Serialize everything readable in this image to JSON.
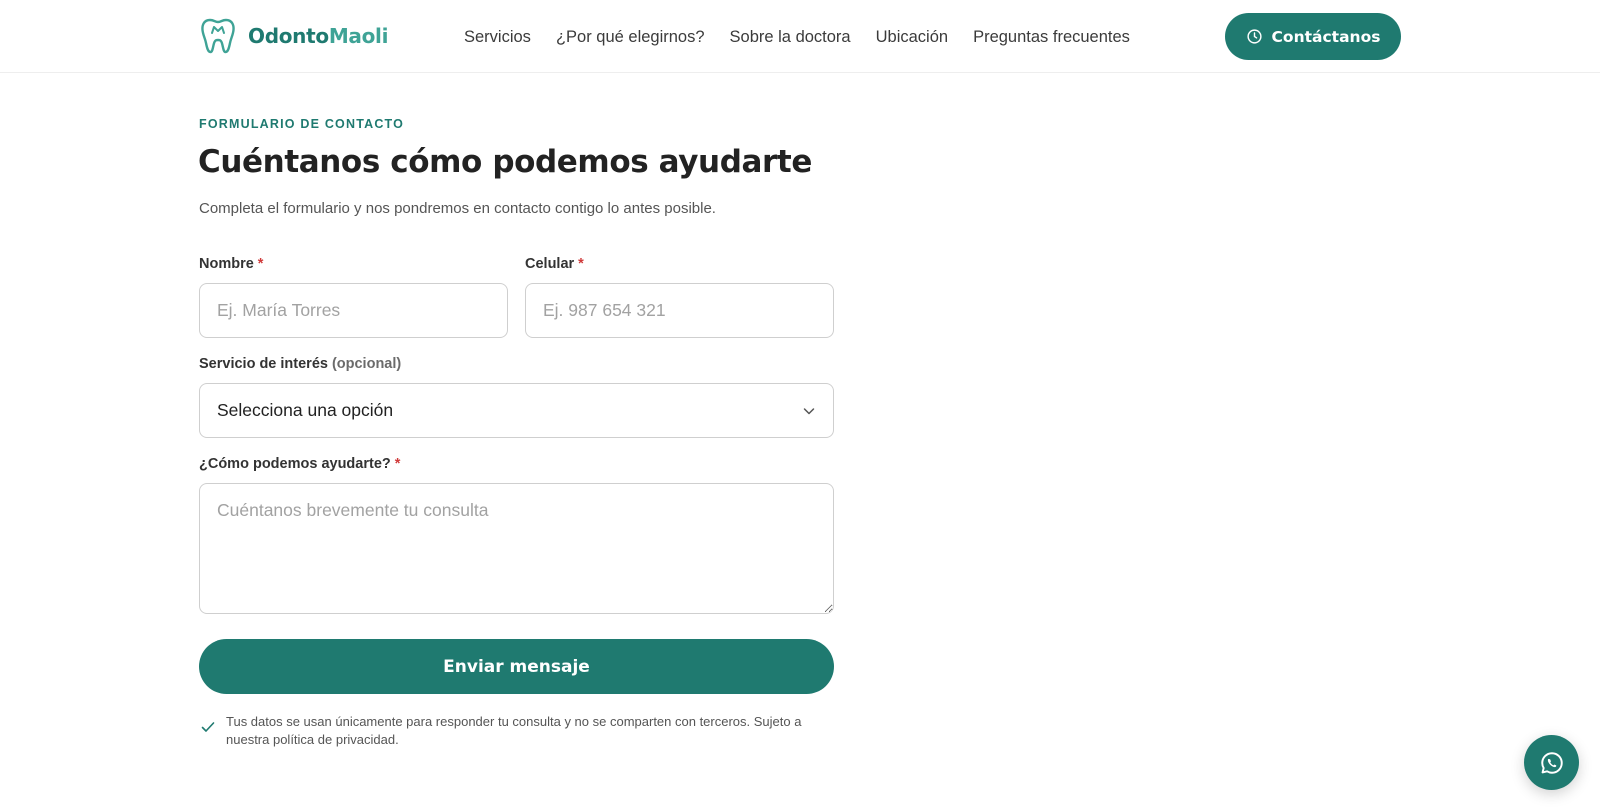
{
  "brand": {
    "name_part1": "Odonto",
    "name_part2": "Maoli",
    "colors": {
      "primary": "#1f7a70",
      "secondary": "#3fa396",
      "required": "#d03a3a"
    },
    "logo_icon": "tooth-icon"
  },
  "nav": {
    "items": [
      {
        "label": "Servicios"
      },
      {
        "label": "¿Por qué elegirnos?"
      },
      {
        "label": "Sobre la doctora"
      },
      {
        "label": "Ubicación"
      },
      {
        "label": "Preguntas frecuentes"
      }
    ],
    "cta": {
      "label": "Contáctanos",
      "icon": "clock-icon"
    }
  },
  "form": {
    "eyebrow": "FORMULARIO DE CONTACTO",
    "title": "Cuéntanos cómo podemos ayudarte",
    "subtitle": "Completa el formulario y nos pondremos en contacto contigo lo antes posible.",
    "name": {
      "label": "Nombre",
      "required_mark": "*",
      "placeholder": "Ej. María Torres",
      "value": ""
    },
    "phone": {
      "label": "Celular",
      "required_mark": "*",
      "placeholder": "Ej. 987 654 321",
      "value": ""
    },
    "service": {
      "label": "Servicio de interés",
      "optional_note": "(opcional)",
      "selected": "Selecciona una opción"
    },
    "message": {
      "label": "¿Cómo podemos ayudarte?",
      "required_mark": "*",
      "placeholder": "Cuéntanos brevemente tu consulta",
      "value": ""
    },
    "submit_label": "Enviar mensaje",
    "privacy_note": "Tus datos se usan únicamente para responder tu consulta y no se comparten con terceros. Sujeto a nuestra política de privacidad."
  },
  "floating": {
    "icon": "whatsapp-icon"
  }
}
